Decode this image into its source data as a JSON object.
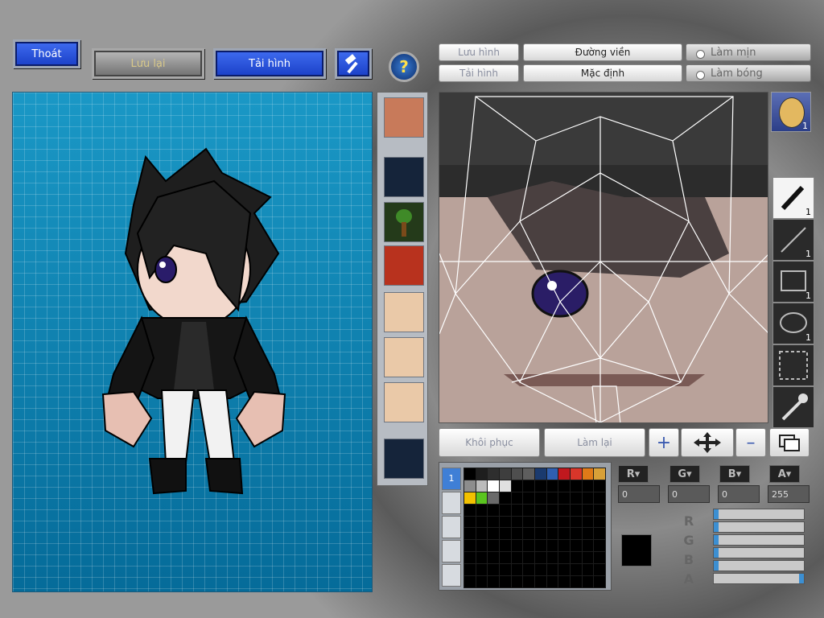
{
  "top_buttons": {
    "exit": "Thoát",
    "save": "Lưu lại",
    "reload": "Tải hình",
    "help_icon": "question-mark"
  },
  "editor_toolbar": {
    "save_image": "Lưu hình",
    "load_image": "Tải hình",
    "outline": "Đường viền",
    "default": "Mặc định",
    "smooth": "Làm mịn",
    "shade": "Làm bóng"
  },
  "tools": {
    "pen_count": "1",
    "line_count": "1",
    "rect_count": "1",
    "ellipse_count": "1",
    "face_count": "1"
  },
  "bottom_buttons": {
    "restore": "Khôi phục",
    "redo": "Làm lại"
  },
  "palette": {
    "tab_active": "1",
    "swatches": [
      "#000000",
      "#1e1e1e",
      "#2e2e2e",
      "#3e3e3e",
      "#4e4e4e",
      "#5e5e5e",
      "#1a3a6e",
      "#2f5fb0",
      "#c0181e",
      "#d8362a",
      "#e07a18",
      "#d8a038",
      "#8d8d8d",
      "#bcbcbc",
      "#ffffff",
      "#e0e0e0",
      "#000000",
      "#000000",
      "#000000",
      "#000000",
      "#000000",
      "#000000",
      "#000000",
      "#000000",
      "#f2c100",
      "#5ac41f",
      "#6a6a6a"
    ]
  },
  "color": {
    "r_label": "R",
    "g_label": "G",
    "b_label": "B",
    "a_label": "A",
    "r": "0",
    "g": "0",
    "b": "0",
    "a": "255",
    "current": "#000000",
    "alpha_fraction": 1.0
  }
}
